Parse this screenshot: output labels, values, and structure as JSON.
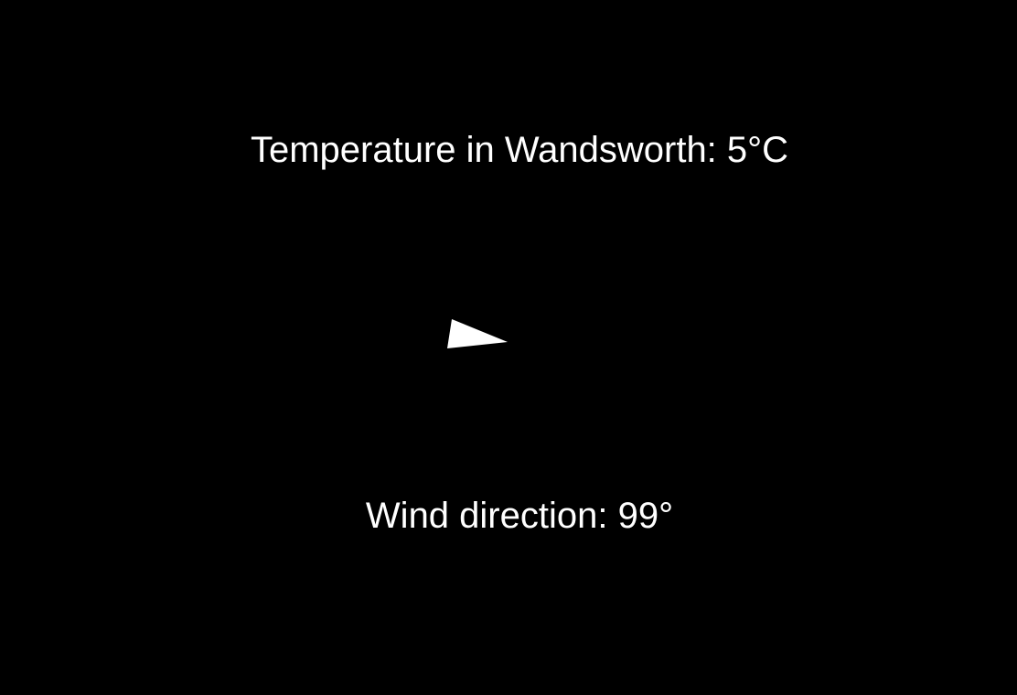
{
  "weather": {
    "temperature_label": "Temperature in Wandsworth: 5°C",
    "wind_label": "Wind direction: 99°",
    "wind_direction_deg": 99,
    "arrow_icon": "wind-direction-arrow-icon"
  },
  "colors": {
    "background": "#000000",
    "foreground": "#ffffff"
  }
}
